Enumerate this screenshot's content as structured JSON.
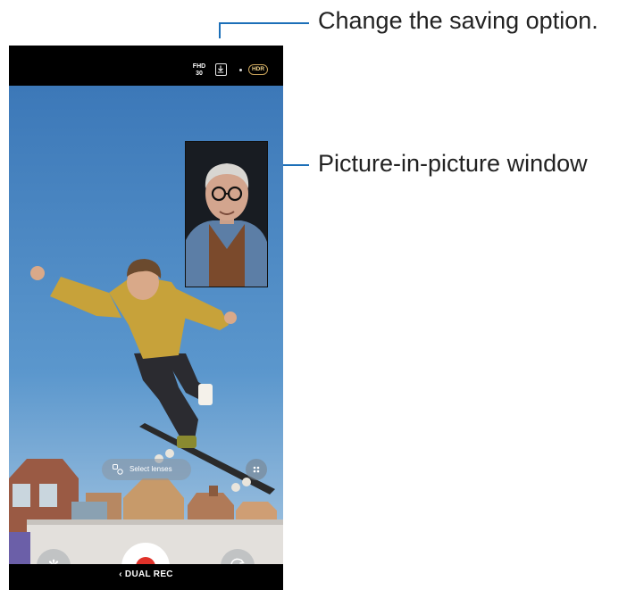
{
  "status": {
    "resolution": "FHD",
    "fps": "30",
    "hdr_label": "HDR"
  },
  "lenses": {
    "label": "Select lenses"
  },
  "mode": {
    "label": "DUAL REC",
    "back_icon": "chevron-left-icon"
  },
  "callouts": {
    "saving_option": "Change the saving option.",
    "pip_window": "Picture-in-picture window"
  },
  "icons": {
    "save": "download-icon",
    "effects": "effects-icon",
    "record": "record-button",
    "switch_camera": "switch-camera-icon",
    "grid": "more-icon"
  },
  "colors": {
    "record": "#e0322a",
    "hdr": "#c9a35a",
    "leader": "#1c6fb8",
    "sky": "#3f7fbf"
  }
}
